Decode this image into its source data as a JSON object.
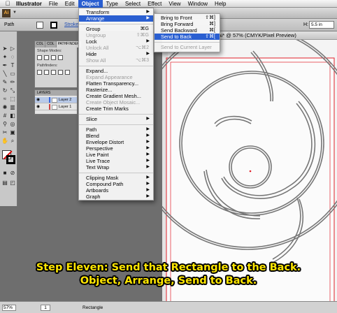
{
  "menubar": {
    "apple": "",
    "items": [
      "Illustrator",
      "File",
      "Edit",
      "Object",
      "Type",
      "Select",
      "Effect",
      "View",
      "Window",
      "Help"
    ],
    "active": "Object"
  },
  "appbar": {
    "logo": "Ai"
  },
  "controlbar": {
    "selection_type": "Path",
    "stroke_label": "Stroke",
    "height_label": "H:",
    "height_value": "5.5 in"
  },
  "panels": {
    "color_tabs": [
      "COL",
      "COL",
      "PATHFINDER"
    ],
    "shape_modes_label": "Shape Modes:",
    "pathfinders_label": "Pathfinders:",
    "layers_tab": "LAYERS",
    "layers": [
      {
        "name": "Layer 2",
        "selected": true
      },
      {
        "name": "Layer 1",
        "selected": false
      }
    ]
  },
  "document": {
    "tab_title": "09.ai* @ 57% (CMYK/Pixel Preview)"
  },
  "object_menu": {
    "items": [
      {
        "label": "Transform",
        "submenu": true
      },
      {
        "label": "Arrange",
        "submenu": true,
        "highlighted": true
      },
      {
        "sep": true
      },
      {
        "label": "Group",
        "shortcut": "⌘G"
      },
      {
        "label": "Ungroup",
        "shortcut": "⇧⌘G",
        "disabled": true
      },
      {
        "label": "Lock",
        "submenu": true
      },
      {
        "label": "Unlock All",
        "shortcut": "⌥⌘2",
        "disabled": true
      },
      {
        "label": "Hide",
        "submenu": true
      },
      {
        "label": "Show All",
        "shortcut": "⌥⌘3",
        "disabled": true
      },
      {
        "sep": true
      },
      {
        "label": "Expand..."
      },
      {
        "label": "Expand Appearance",
        "disabled": true
      },
      {
        "label": "Flatten Transparency..."
      },
      {
        "label": "Rasterize..."
      },
      {
        "label": "Create Gradient Mesh..."
      },
      {
        "label": "Create Object Mosaic...",
        "disabled": true
      },
      {
        "label": "Create Trim Marks"
      },
      {
        "sep": true
      },
      {
        "label": "Slice",
        "submenu": true
      },
      {
        "sep": true
      },
      {
        "label": "Path",
        "submenu": true
      },
      {
        "label": "Blend",
        "submenu": true
      },
      {
        "label": "Envelope Distort",
        "submenu": true
      },
      {
        "label": "Perspective",
        "submenu": true
      },
      {
        "label": "Live Paint",
        "submenu": true
      },
      {
        "label": "Live Trace",
        "submenu": true
      },
      {
        "label": "Text Wrap",
        "submenu": true
      },
      {
        "sep": true
      },
      {
        "label": "Clipping Mask",
        "submenu": true
      },
      {
        "label": "Compound Path",
        "submenu": true
      },
      {
        "label": "Artboards",
        "submenu": true
      },
      {
        "label": "Graph",
        "submenu": true
      }
    ]
  },
  "arrange_menu": {
    "items": [
      {
        "label": "Bring to Front",
        "shortcut": "⇧⌘]"
      },
      {
        "label": "Bring Forward",
        "shortcut": "⌘]"
      },
      {
        "label": "Send Backward",
        "shortcut": "⌘["
      },
      {
        "label": "Send to Back",
        "shortcut": "⇧⌘[",
        "highlighted": true
      },
      {
        "sep": true
      },
      {
        "label": "Send to Current Layer",
        "disabled": true
      }
    ]
  },
  "statusbar": {
    "zoom": "57%",
    "page": "1",
    "selection": "Rectangle"
  },
  "caption": {
    "line1": "Step Eleven: Send that Rectangle to the Back.",
    "line2": "Object, Arrange, Send to Back."
  },
  "colors": {
    "menu_highlight": "#2a5fd1",
    "artboard_border": "#e0202a",
    "caption_text": "#ffe600"
  }
}
